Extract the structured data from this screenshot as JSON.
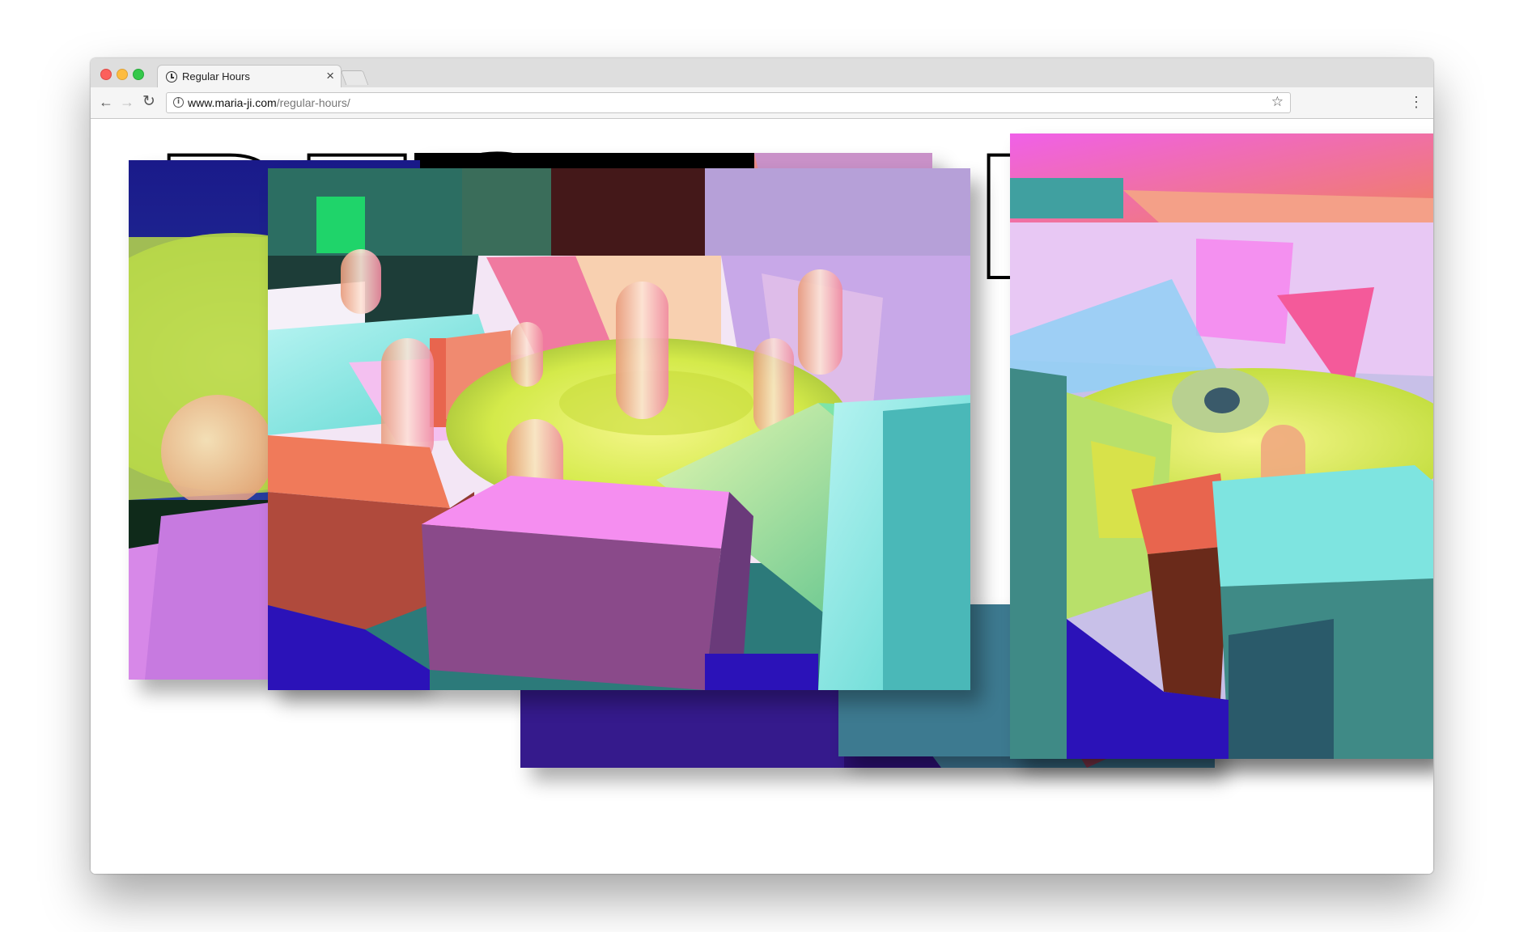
{
  "browser": {
    "tab_title": "Regular Hours",
    "tab_close": "×",
    "url_domain": "www.maria-ji.com",
    "url_path": "/regular-hours/",
    "icons": {
      "back": "arrow-left-icon",
      "forward": "arrow-right-icon",
      "reload": "reload-icon",
      "info": "info-icon",
      "bookmark": "star-icon",
      "menu": "kebab-menu-icon",
      "tab": "clock-icon"
    }
  },
  "page": {
    "heading": "REGULAR HOURS"
  },
  "colors": {
    "cyan": "#6ee8e3",
    "pink": "#f58ef0",
    "coral": "#e8654e",
    "lime": "#d4ea4a",
    "indigo": "#2b12b8",
    "teal": "#3f8a86"
  }
}
